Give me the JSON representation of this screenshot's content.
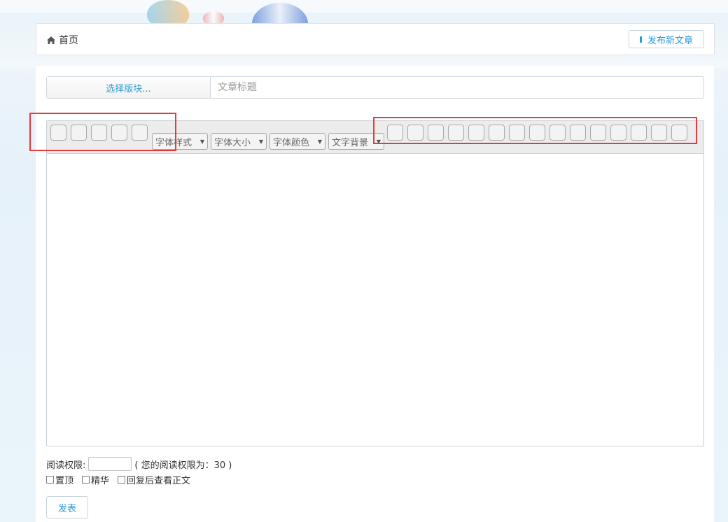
{
  "breadcrumb": {
    "icon": "home-icon",
    "label": "首页"
  },
  "header": {
    "new_post_label": "发布新文章"
  },
  "form": {
    "section_button_label": "选择版块...",
    "title_placeholder": "文章标题",
    "title_value": ""
  },
  "toolbar": {
    "selects": [
      {
        "label": "字体样式"
      },
      {
        "label": "字体大小"
      },
      {
        "label": "字体颜色"
      },
      {
        "label": "文字背景"
      }
    ]
  },
  "permission": {
    "label": "阅读权限:",
    "value": "",
    "note": "( 您的阅读权限为：30 )"
  },
  "options": [
    {
      "label": "置顶",
      "checked": false
    },
    {
      "label": "精华",
      "checked": false
    },
    {
      "label": "回复后查看正文",
      "checked": false
    }
  ],
  "submit": {
    "label": "发表"
  },
  "colors": {
    "accent": "#2a9ad8",
    "highlight": "#e8393c",
    "toolbar_bg": "#ececec"
  }
}
